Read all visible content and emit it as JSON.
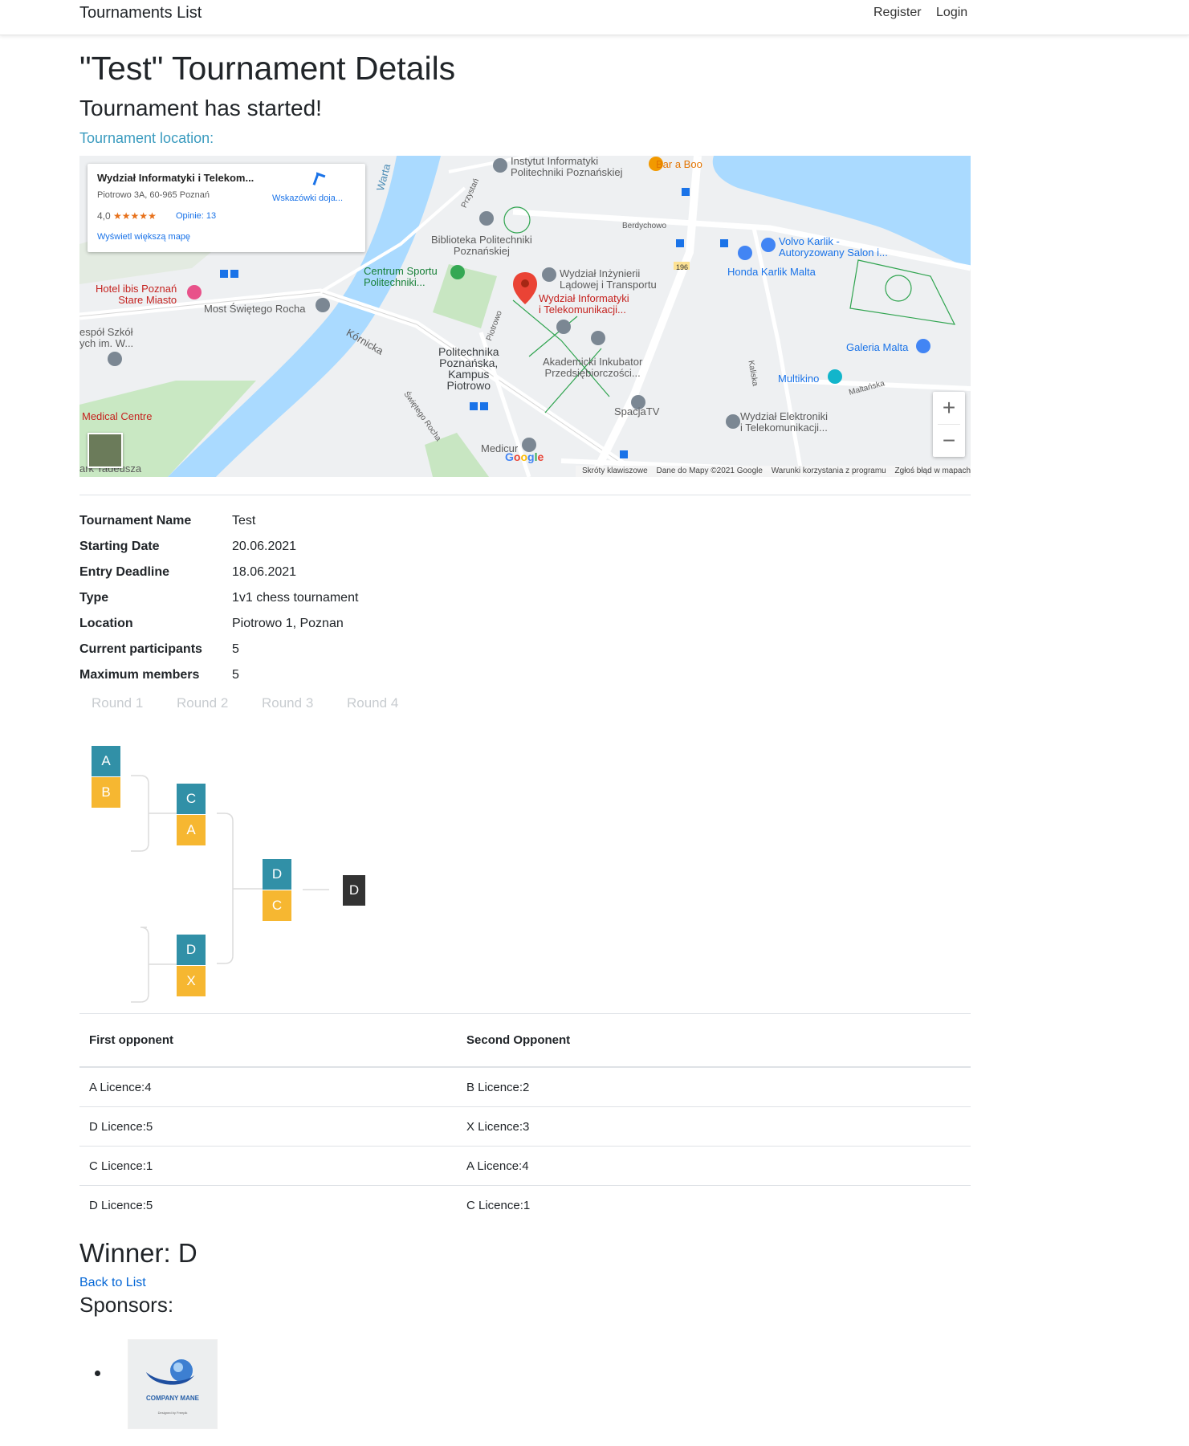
{
  "navbar": {
    "brand": "Tournaments List",
    "register": "Register",
    "login": "Login"
  },
  "header": {
    "title": "\"Test\" Tournament Details",
    "status": "Tournament has started!",
    "location_label": "Tournament location:"
  },
  "map": {
    "card_name": "Wydział Informatyki i Telekom...",
    "card_address": "Piotrowo 3A, 60-965 Poznań",
    "card_rating": "4,0",
    "card_stars": "★★★★★",
    "card_reviews": "Opinie: 13",
    "card_larger_map": "Wyświetl większą mapę",
    "card_directions": "Wskazówki doja...",
    "labels": {
      "instytut": "Instytut Informatyki\nPolitechniki Poznańskiej",
      "bar": "Bar a Boo",
      "biblioteka": "Biblioteka Politechniki\nPoznańskiej",
      "centrum": "Centrum Sportu\nPolitechniki...",
      "wil": "Wydział Inżynierii\nLądowej i Transportu",
      "wiit": "Wydział Informatyki\ni Telekomunikacji...",
      "hotel": "Hotel ibis Poznań\nStare Miasto",
      "most": "Most Świętego Rocha",
      "zespol": "espół Szkół\nych im. W...",
      "kampus": "Politechnika\nPoznańska,\nKampus\nPiotrowo",
      "inkubator": "Akademicki Inkubator\nPrzedsiębiorczości...",
      "spacja": "SpacjaTV",
      "medical": "Medical Centre",
      "medicur": "Medicur",
      "volvo": "Volvo Karlik -\nAutoryzowany Salon i...",
      "honda": "Honda Karlik Malta",
      "galeria": "Galeria Malta",
      "multikino": "Multikino",
      "elektronika": "Wydział Elektroniki\ni Telekomunikacji...",
      "park": "ark Tadeusza",
      "warta": "Warta",
      "kornicka": "Kórnicka",
      "berdychowo": "Berdychowo",
      "piotrowo": "Piotrowo",
      "przystan": "Przystań",
      "swrocha": "Świętego Rocha",
      "kaliska": "Kaliska",
      "maltanska": "Maltańska",
      "route": "196"
    },
    "google": "Google",
    "attrib_shortcuts": "Skróty klawiszowe",
    "attrib_data": "Dane do Mapy ©2021 Google",
    "attrib_terms": "Warunki korzystania z programu",
    "attrib_report": "Zgłoś błąd w mapach",
    "zoom_in": "+",
    "zoom_out": "−"
  },
  "details": [
    {
      "label": "Tournament Name",
      "value": "Test"
    },
    {
      "label": "Starting Date",
      "value": "20.06.2021"
    },
    {
      "label": "Entry Deadline",
      "value": "18.06.2021"
    },
    {
      "label": "Type",
      "value": "1v1 chess tournament"
    },
    {
      "label": "Location",
      "value": "Piotrowo 1, Poznan"
    },
    {
      "label": "Current participants",
      "value": "5"
    },
    {
      "label": "Maximum members",
      "value": "5"
    }
  ],
  "bracket": {
    "rounds": [
      "Round 1",
      "Round 2",
      "Round 3",
      "Round 4"
    ],
    "r1": [
      {
        "top": "A",
        "bottom": "B"
      }
    ],
    "r2": [
      {
        "top": "C",
        "bottom": "A"
      },
      {
        "top": "D",
        "bottom": "X"
      }
    ],
    "r3": [
      {
        "top": "D",
        "bottom": "C"
      }
    ],
    "r4": "D"
  },
  "matches": {
    "headers": [
      "First opponent",
      "Second Opponent"
    ],
    "rows": [
      [
        "A Licence:4",
        "B Licence:2"
      ],
      [
        "D Licence:5",
        "X Licence:3"
      ],
      [
        "C Licence:1",
        "A Licence:4"
      ],
      [
        "D Licence:5",
        "C Licence:1"
      ]
    ]
  },
  "winner": "Winner: D",
  "back_link": "Back to List",
  "sponsors_title": "Sponsors:",
  "sponsor": {
    "name": "COMPANY MANE",
    "tagline": "Designed by Freepik"
  }
}
